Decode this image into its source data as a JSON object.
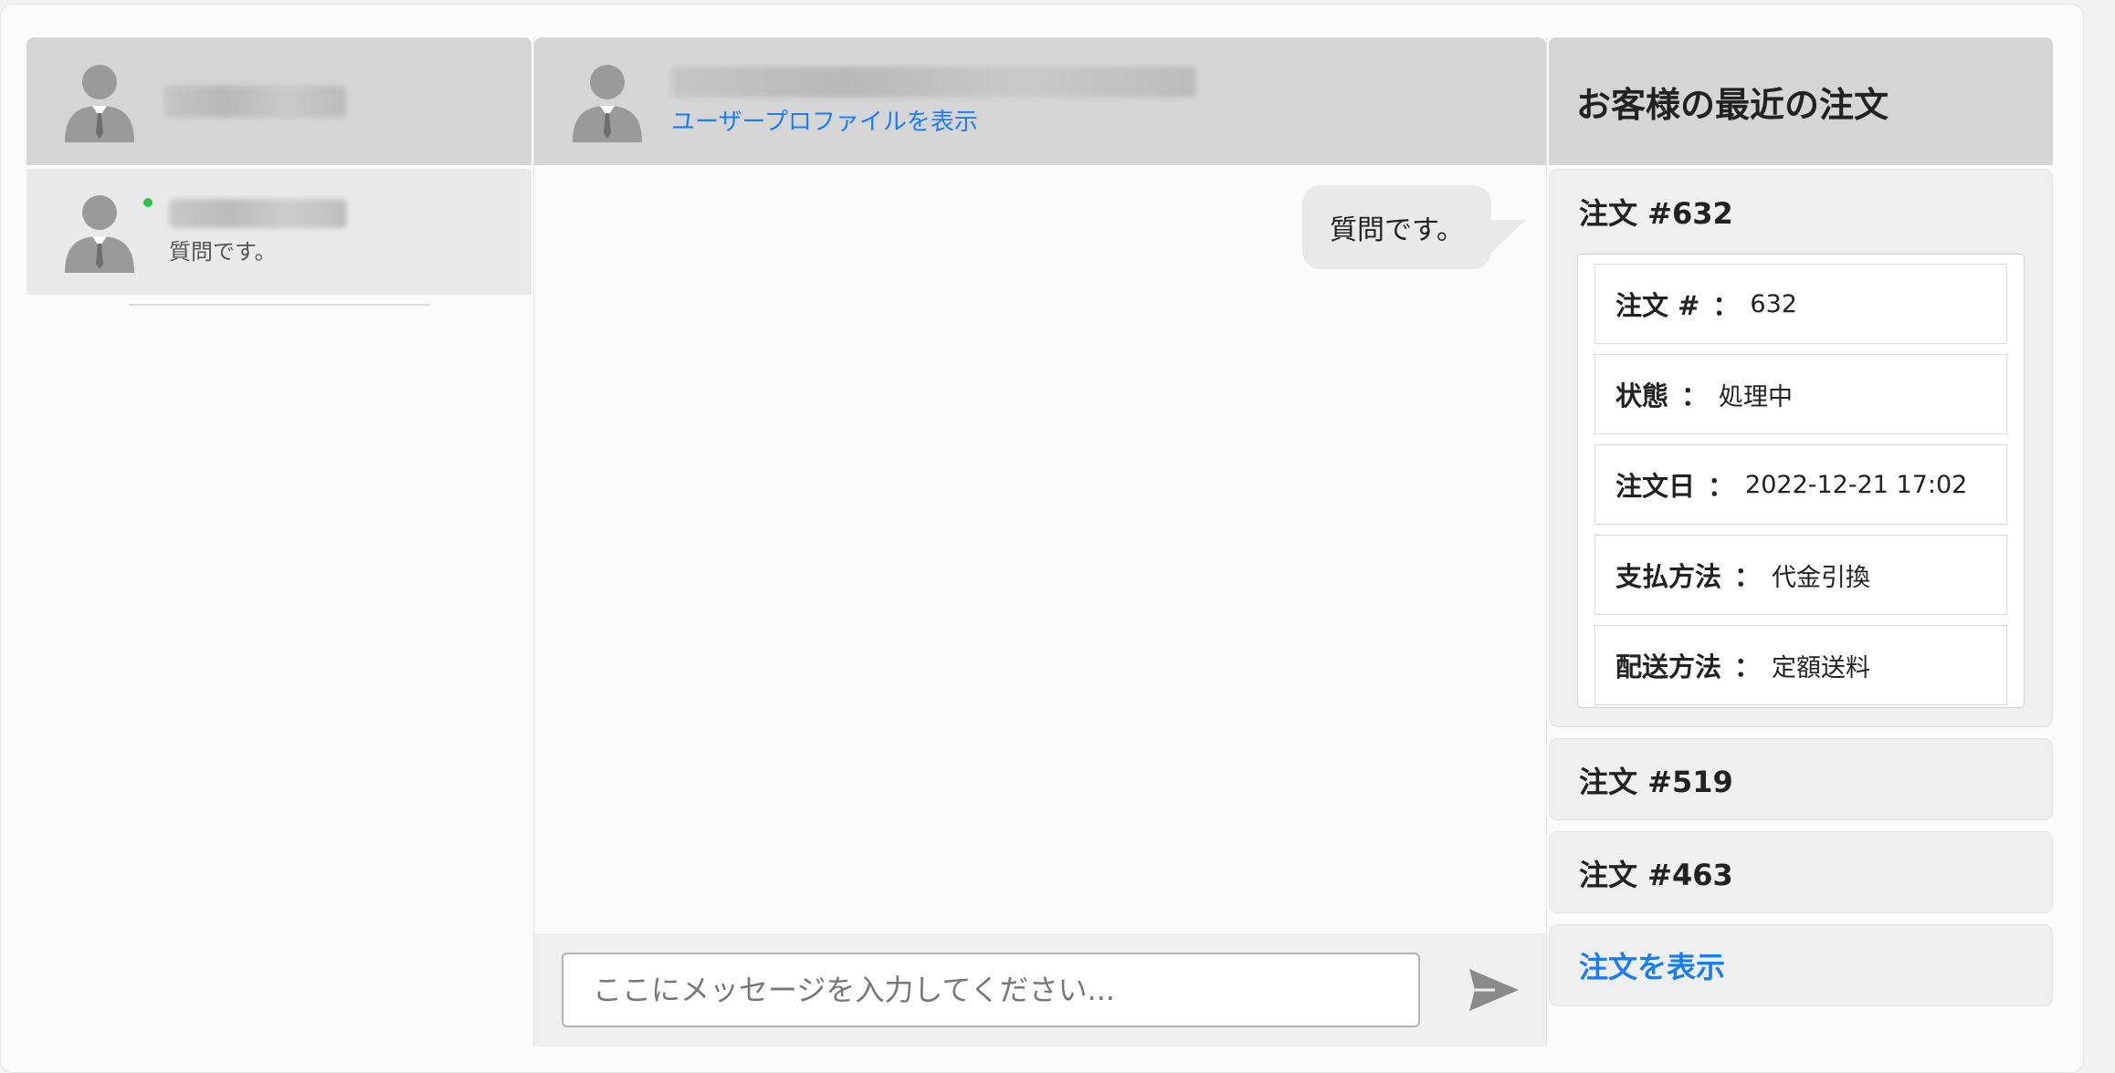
{
  "sidebar": {
    "conversations": [
      {
        "preview": "質問です。",
        "online": true
      }
    ]
  },
  "chat": {
    "profile_link": "ユーザープロファイルを表示",
    "messages": [
      {
        "text": "質問です。",
        "side": "right"
      }
    ],
    "input": {
      "placeholder": "ここにメッセージを入力してください...",
      "value": ""
    },
    "send_icon": "send-icon"
  },
  "orders_panel": {
    "title": "お客様の最近の注文",
    "orders": [
      {
        "title": "注文 #632",
        "expanded": true,
        "details": [
          {
            "label": "注文 #",
            "colon": "：",
            "value": "632"
          },
          {
            "label": "状態",
            "colon": "：",
            "value": "処理中"
          },
          {
            "label": "注文日",
            "colon": "：",
            "value": "2022-12-21 17:02"
          },
          {
            "label": "支払方法",
            "colon": "：",
            "value": "代金引換"
          },
          {
            "label": "配送方法",
            "colon": "：",
            "value": "定額送料"
          }
        ]
      },
      {
        "title": "注文 #519",
        "expanded": false
      },
      {
        "title": "注文 #463",
        "expanded": false
      }
    ],
    "view_orders_link": "注文を表示"
  },
  "colors": {
    "link": "#1a7df0",
    "online": "#2ec44a",
    "header_bg": "#d5d5d5"
  }
}
